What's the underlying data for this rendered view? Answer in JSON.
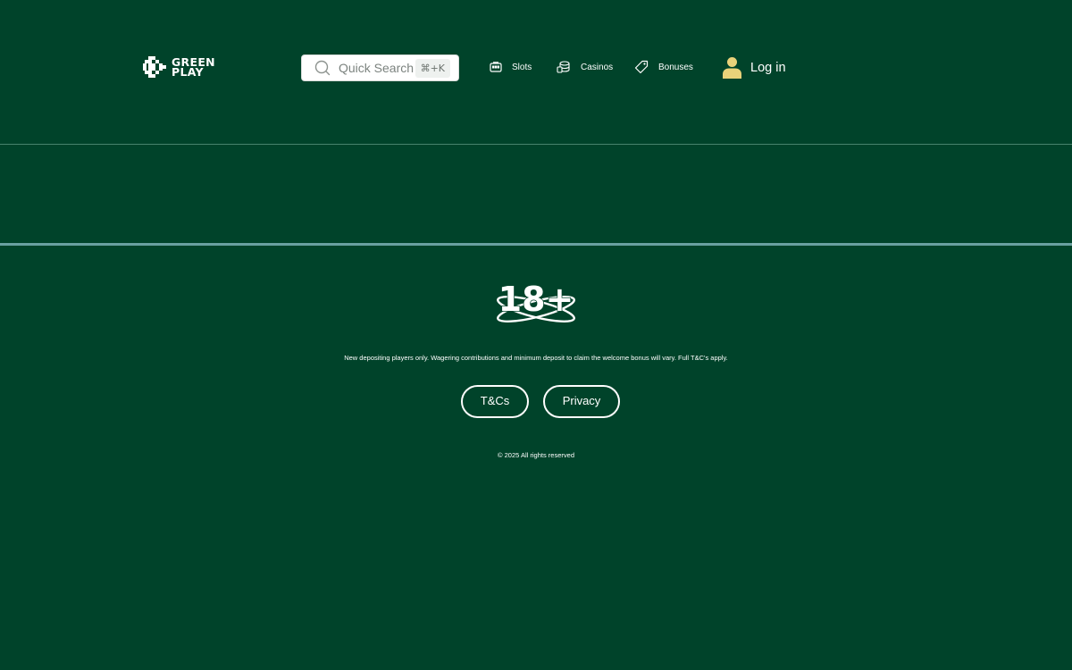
{
  "brand": {
    "logo_line1": "GREEN",
    "logo_line2": "PLAY",
    "logo_icon": "green-play-logo-icon"
  },
  "search": {
    "placeholder": "Quick Search",
    "shortcut": "⌘+K",
    "icon": "search-icon"
  },
  "nav": {
    "items": [
      {
        "label": "Slots",
        "icon": "slot-machine-icon"
      },
      {
        "label": "Casinos",
        "icon": "coins-stack-icon"
      },
      {
        "label": "Bonuses",
        "icon": "tag-icon"
      }
    ]
  },
  "login": {
    "label": "Log in",
    "icon": "user-icon",
    "icon_color": "#e9d27a"
  },
  "footer": {
    "age_badge": "18+",
    "disclaimer": "New depositing players only. Wagering contributions and minimum deposit to claim the welcome bonus will vary. Full T&C's apply.",
    "links": [
      {
        "label": "T&Cs"
      },
      {
        "label": "Privacy"
      }
    ],
    "copyright": "© 2025 All rights reserved"
  },
  "colors": {
    "background": "#00432a",
    "divider": "#6aa0a0",
    "text": "#ffffff"
  }
}
